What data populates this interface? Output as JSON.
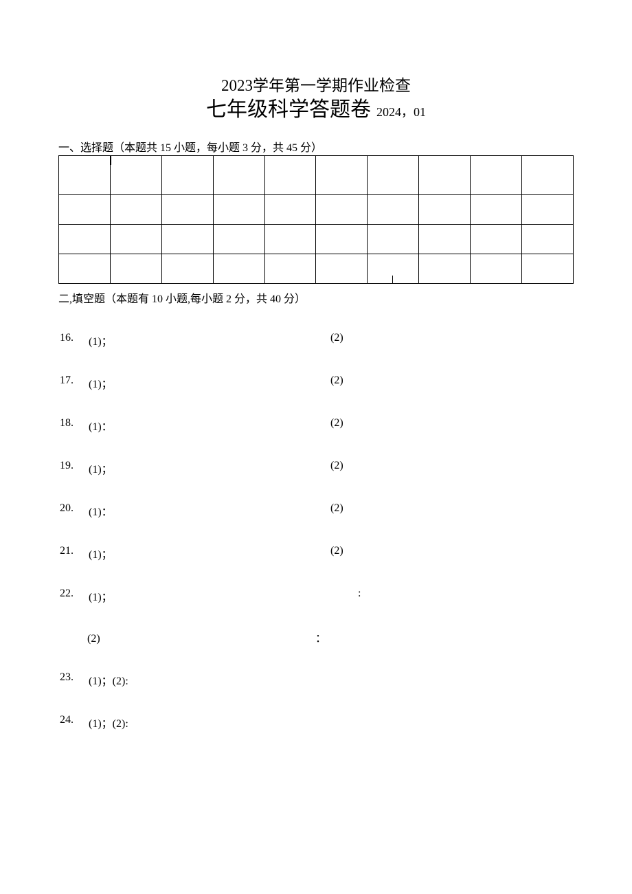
{
  "title": {
    "year": "2023",
    "line1_rest": "学年第一学期作业检查",
    "line2": "七年级科学答题卷",
    "date_year": "2024",
    "date_sep": "，",
    "date_mon": "01"
  },
  "section1": {
    "heading": "一、选择题（本题共 15 小题，每小题 3 分，共 45 分）"
  },
  "section2": {
    "heading": "二,填空题（本题有 10 小题,每小题 2 分，共 40 分）"
  },
  "questions": [
    {
      "n": "16.",
      "a": "(1)",
      "ap": "；",
      "b": "(2)"
    },
    {
      "n": "17.",
      "a": "(1)",
      "ap": "；",
      "b": "(2)"
    },
    {
      "n": "18.",
      "a": "(1)",
      "ap": "：",
      "b": "(2)"
    },
    {
      "n": "19.",
      "a": "(1)",
      "ap": "；",
      "b": "(2)"
    },
    {
      "n": "20.",
      "a": "(1)",
      "ap": "：",
      "b": "(2)"
    },
    {
      "n": "21.",
      "a": "(1)",
      "ap": "；",
      "b": "(2)"
    }
  ],
  "q22": {
    "n": "22.",
    "a": "(1)",
    "ap": "；",
    "trail1": ":",
    "b": "(2)",
    "trail2": "："
  },
  "q23": {
    "n": "23.",
    "a": "(1)",
    "ap": "；",
    "b": "(2)",
    "bp": ":"
  },
  "q24": {
    "n": "24.",
    "a": "(1)",
    "ap": "；",
    "b": "(2)",
    "bp": ":"
  }
}
